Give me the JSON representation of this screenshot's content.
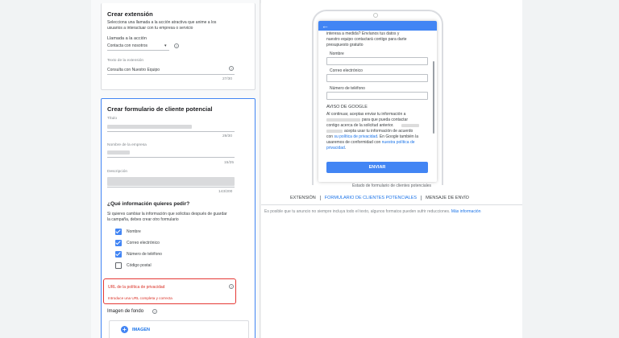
{
  "extension_card": {
    "title": "Crear extensión",
    "description_line1": "Selecciona una llamada a la acción atractiva que anime a los",
    "description_line2": "usuarios a interactuar con tu empresa o servicio",
    "cta_label": "Llamada a la acción",
    "cta_value": "Contacta con nosotros",
    "ext_text_label": "Texto de la extensión",
    "ext_text_value": "Consulta con Nuestro Equipo",
    "ext_text_counter": "27/30"
  },
  "lead_form_card": {
    "title": "Crear formulario de cliente potencial",
    "title_field_label": "Título",
    "title_counter": "29/30",
    "business_label": "Nombre de la empresa",
    "business_counter": "15/25",
    "description_label": "Descripción",
    "description_counter": "143/200",
    "question_heading": "¿Qué información quieres pedir?",
    "question_note_line1": "Si quieres cambiar la información que solicitas después de guardar",
    "question_note_line2": "la campaña, debes crear otro formulario",
    "checkboxes": [
      {
        "label": "Nombre",
        "checked": true
      },
      {
        "label": "Correo electrónico",
        "checked": true
      },
      {
        "label": "Número de teléfono",
        "checked": true
      },
      {
        "label": "Código postal",
        "checked": false
      }
    ],
    "privacy_url_label": "URL de la política de privacidad",
    "privacy_url_error": "Introduce una URL completa y correcta",
    "background_image_label": "Imagen de fondo",
    "image_button_label": "IMAGEN"
  },
  "preview": {
    "intro_line1": "interesa a medida? Envíanos tus datos y",
    "intro_line2": "nuestro equipo contactará contigo para darte",
    "intro_line3": "presupuesto gratuito",
    "field_name": "Nombre",
    "field_email": "Correo electrónico",
    "field_phone": "Número de teléfono",
    "google_notice_title": "AVISO DE GOOGLE",
    "notice_line1": "Al continuar, aceptas enviar tu información a",
    "notice_line2": "para que pueda contactar",
    "notice_line3": "contigo acerca de la solicitud anterior.",
    "notice_line4": "acepta usar tu información de acuerdo",
    "notice_line5_pre": "con",
    "notice_line5_link": "su política de privacidad",
    "notice_line5_post": ". En Google también la",
    "notice_line6_pre": "usaremos de conformidad con",
    "notice_line6_link": "nuestra política de",
    "notice_line7_link": "privacidad",
    "notice_line7_post": ".",
    "send_button": "ENVIAR",
    "caption": "Estado de formulario de clientes potenciales",
    "tabs": [
      "EXTENSIÓN",
      "FORMULARIO DE CLIENTES POTENCIALES",
      "MENSAJE DE ENVÍO"
    ],
    "footnote": "Es posible que tu anuncio no siempre incluya todo el texto, algunos formatos pueden sufrir reducciones.",
    "footnote_link": "Más información"
  },
  "colors": {
    "accent": "#4285f4",
    "link": "#1a73e8",
    "error": "#e53935"
  }
}
